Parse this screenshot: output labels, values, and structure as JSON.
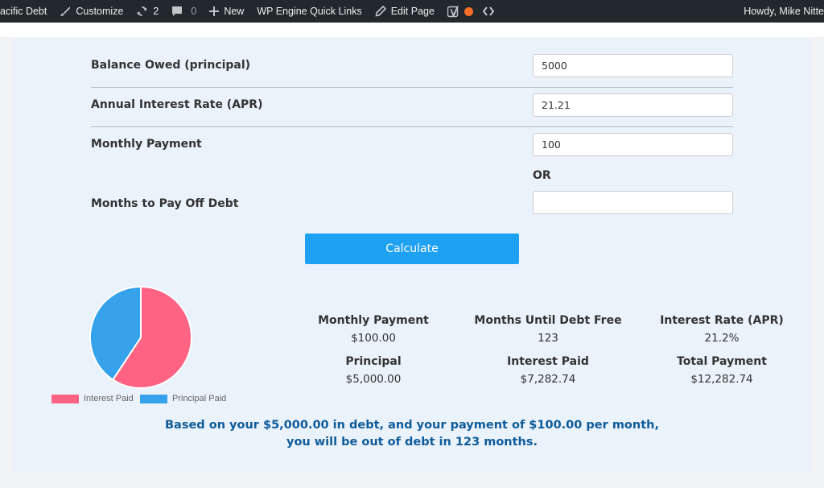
{
  "adminbar": {
    "site_name": "acific Debt",
    "customize": "Customize",
    "updates_count": "2",
    "comments_count": "0",
    "new": "New",
    "quick_links": "WP Engine Quick Links",
    "edit_page": "Edit Page",
    "howdy": "Howdy, Mike Nitte"
  },
  "form": {
    "balance_label": "Balance Owed (principal)",
    "balance_value": "5000",
    "apr_label": "Annual Interest Rate (APR)",
    "apr_value": "21.21",
    "payment_label": "Monthly Payment",
    "payment_value": "100",
    "or_text": "OR",
    "months_label": "Months to Pay Off Debt",
    "months_value": "",
    "calculate_button": "Calculate"
  },
  "chart_data": {
    "type": "pie",
    "labels": [
      "Interest Paid",
      "Principal Paid"
    ],
    "values": [
      7282.74,
      5000.0
    ],
    "colors": [
      "#ff6384",
      "#36a2eb"
    ],
    "legend_position": "bottom"
  },
  "results": {
    "monthly_payment_label": "Monthly Payment",
    "monthly_payment_value": "$100.00",
    "months_label": "Months Until Debt Free",
    "months_value": "123",
    "rate_label": "Interest Rate (APR)",
    "rate_value": "21.2%",
    "principal_label": "Principal",
    "principal_value": "$5,000.00",
    "interest_label": "Interest Paid",
    "interest_value": "$7,282.74",
    "total_label": "Total Payment",
    "total_value": "$12,282.74"
  },
  "summary_text": "Based on your $5,000.00 in debt, and your payment of $100.00 per month, you will be out of debt in 123 months."
}
